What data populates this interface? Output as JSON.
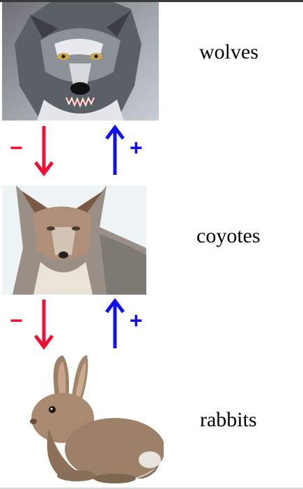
{
  "animals": [
    {
      "key": "wolf",
      "label": "wolves"
    },
    {
      "key": "coyote",
      "label": "coyotes"
    },
    {
      "key": "rabbit",
      "label": "rabbits"
    }
  ],
  "relations": [
    {
      "from": "wolves",
      "to": "coyotes",
      "down_sign": "−",
      "up_sign": "+"
    },
    {
      "from": "coyotes",
      "to": "rabbits",
      "down_sign": "−",
      "up_sign": "+"
    }
  ],
  "colors": {
    "negative": "#ee1133",
    "positive": "#1010ee",
    "text": "#000000"
  }
}
